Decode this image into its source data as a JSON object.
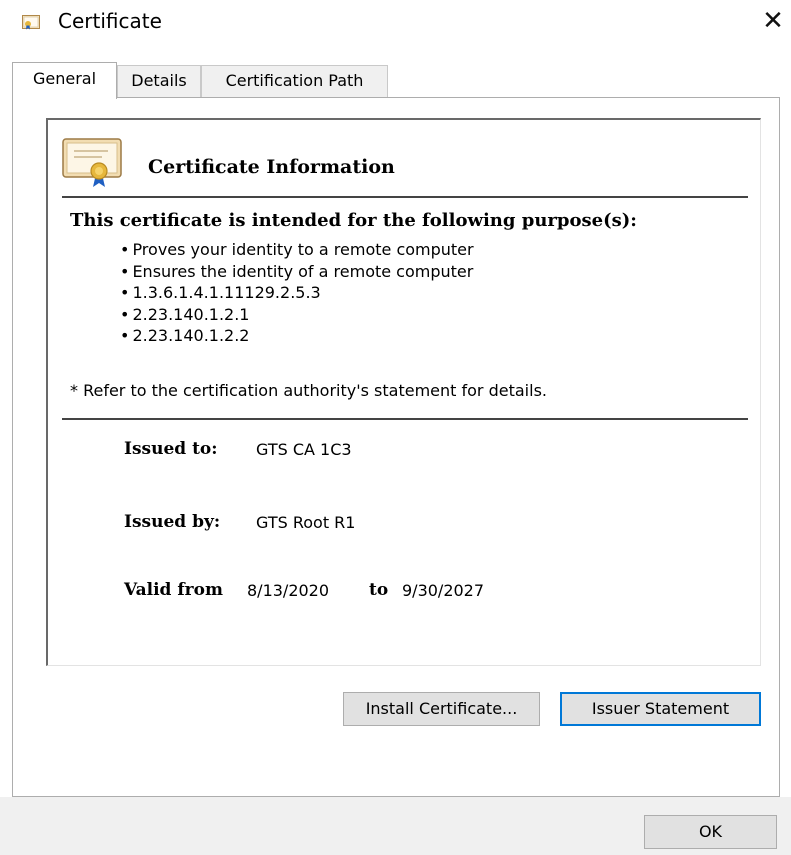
{
  "window": {
    "title": "Certificate",
    "close_glyph": "✕"
  },
  "tabs": [
    {
      "label": "General",
      "active": true
    },
    {
      "label": "Details",
      "active": false
    },
    {
      "label": "Certification Path",
      "active": false
    }
  ],
  "info": {
    "title": "Certificate Information",
    "purpose_heading": "This certificate is intended for the following purpose(s):",
    "purposes": [
      "Proves your identity to a remote computer",
      "Ensures the identity of a remote computer",
      "1.3.6.1.4.1.11129.2.5.3",
      "2.23.140.1.2.1",
      "2.23.140.1.2.2"
    ],
    "note": "* Refer to the certification authority's statement for details.",
    "issued_to_label": "Issued to:",
    "issued_to": "GTS CA 1C3",
    "issued_by_label": "Issued by:",
    "issued_by": "GTS Root R1",
    "valid_from_label": "Valid from",
    "valid_from": "8/13/2020",
    "to_label": "to",
    "valid_to": "9/30/2027"
  },
  "buttons": {
    "install": "Install Certificate...",
    "issuer": "Issuer Statement",
    "ok": "OK"
  },
  "icons": {
    "title": "certificate-icon",
    "info": "certificate-icon",
    "close": "close-icon"
  },
  "colors": {
    "focus": "#0078d7",
    "ribbon": "#1f5fc2",
    "seal": "#e6b73c"
  }
}
